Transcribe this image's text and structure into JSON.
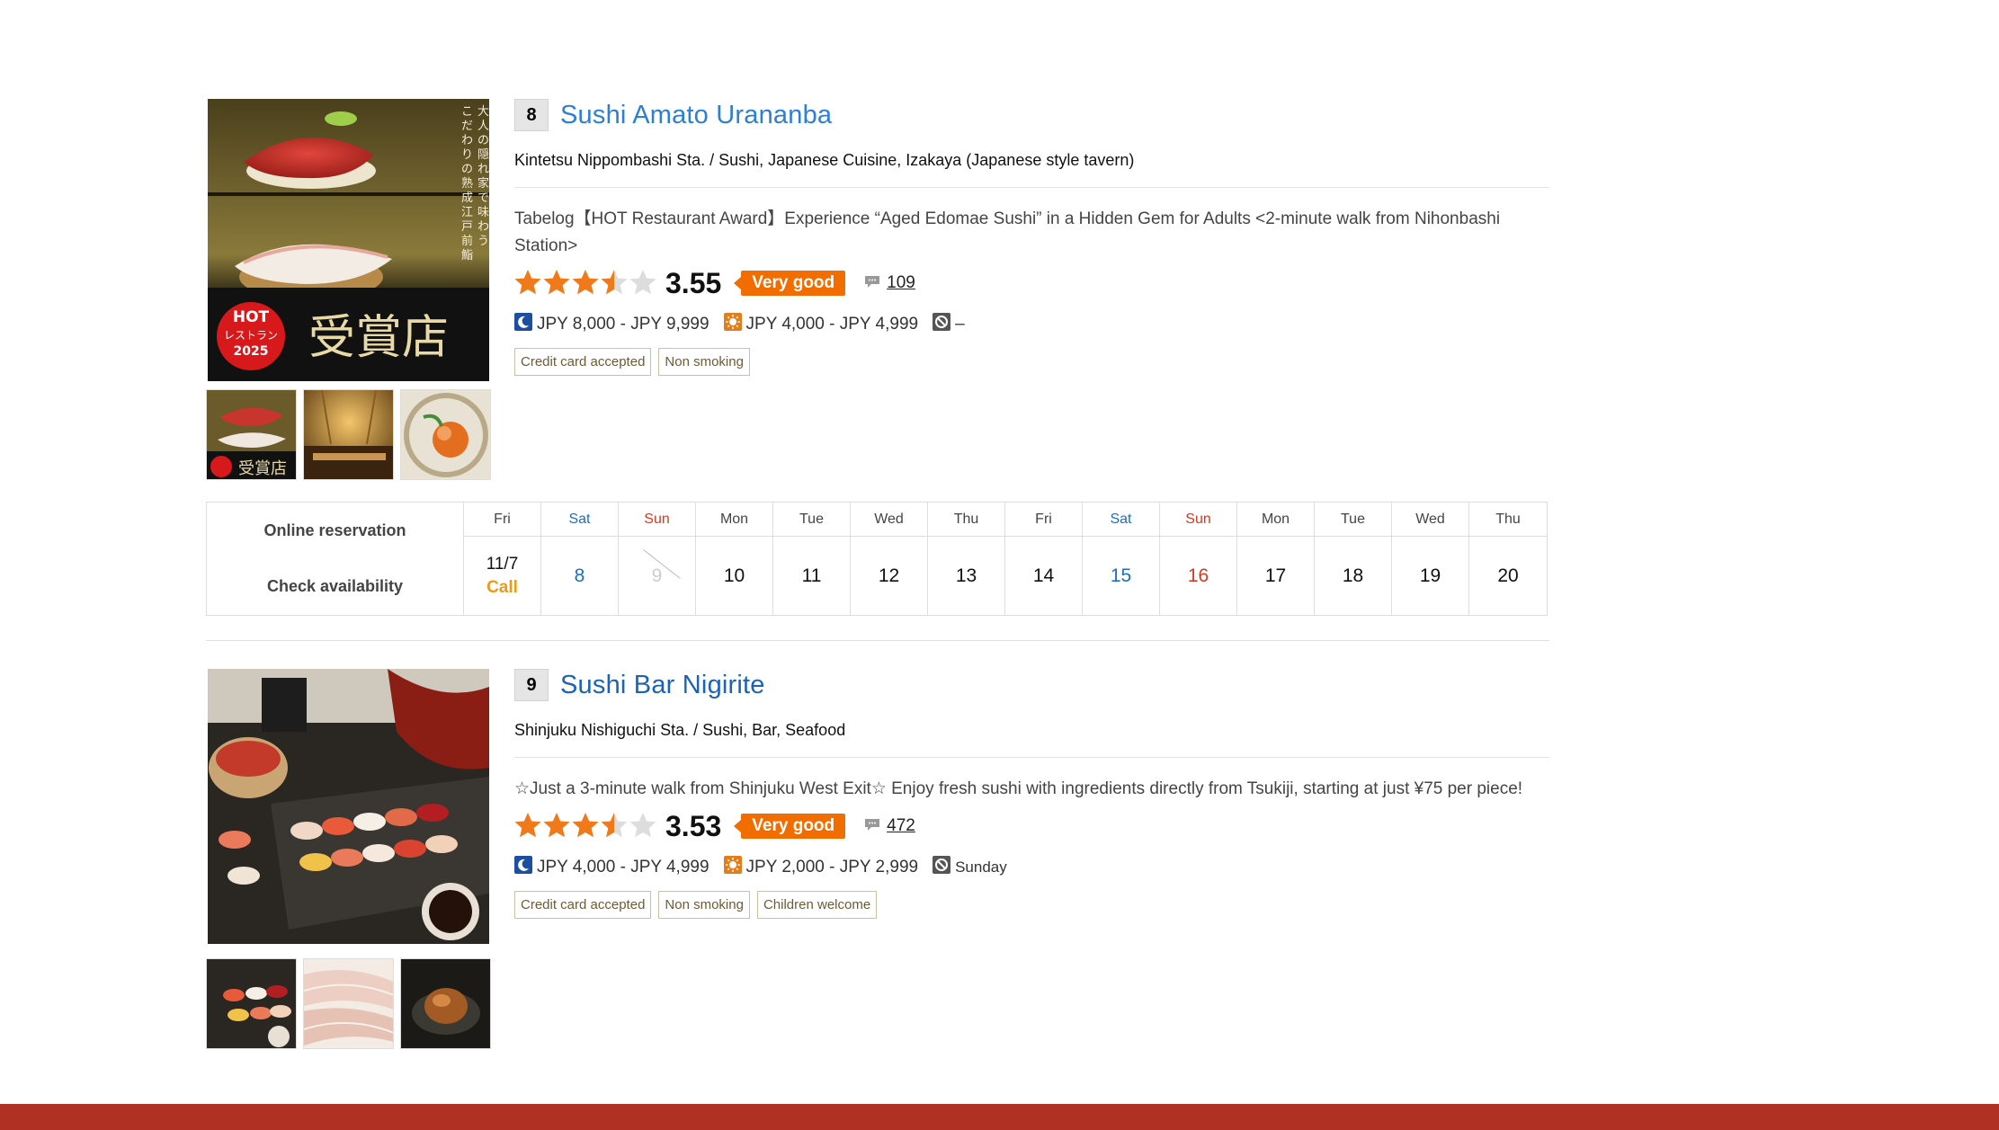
{
  "listings": [
    {
      "rank": "8",
      "name": "Sushi Amato Urananba",
      "area": "Kintetsu Nippombashi Sta. / Sushi, Japanese Cuisine, Izakaya (Japanese style tavern)",
      "pr": "Tabelog【HOT Restaurant Award】Experience “Aged Edomae Sushi” in a Hidden Gem for Adults <2-minute walk from Nihonbashi Station>",
      "rating": {
        "score": "3.55",
        "stars": 3.5,
        "label": "Very good"
      },
      "reviews": "109",
      "dinner_price": "JPY 8,000 - JPY 9,999",
      "lunch_price": "JPY 4,000 - JPY 4,999",
      "holiday": "–",
      "tags": [
        "Credit card accepted",
        "Non smoking"
      ],
      "photo": {
        "award_badge": "HOT\nレストラン\n2025",
        "award_text": "受賞店",
        "vertical_text": "大人の隠れ家で味わうこだわりの熟成江戸前鮨"
      }
    },
    {
      "rank": "9",
      "name": "Sushi Bar Nigirite",
      "area": "Shinjuku Nishiguchi Sta. / Sushi, Bar, Seafood",
      "pr": "☆Just a 3-minute walk from Shinjuku West Exit☆ Enjoy fresh sushi with ingredients directly from Tsukiji, starting at just ¥75 per piece!",
      "rating": {
        "score": "3.53",
        "stars": 3.5,
        "label": "Very good"
      },
      "reviews": "472",
      "dinner_price": "JPY 4,000 - JPY 4,999",
      "lunch_price": "JPY 2,000 - JPY 2,999",
      "holiday": "Sunday",
      "tags": [
        "Credit card accepted",
        "Non smoking",
        "Children welcome"
      ]
    }
  ],
  "reservation": {
    "online_label": "Online reservation",
    "check_label": "Check availability",
    "days": [
      {
        "dow": "Fri",
        "date": "11/7",
        "extra": "Call",
        "kind": "wd"
      },
      {
        "dow": "Sat",
        "date": "8",
        "kind": "sat"
      },
      {
        "dow": "Sun",
        "date": "9",
        "kind": "sun",
        "closed": true
      },
      {
        "dow": "Mon",
        "date": "10",
        "kind": "wd"
      },
      {
        "dow": "Tue",
        "date": "11",
        "kind": "wd"
      },
      {
        "dow": "Wed",
        "date": "12",
        "kind": "wd"
      },
      {
        "dow": "Thu",
        "date": "13",
        "kind": "wd"
      },
      {
        "dow": "Fri",
        "date": "14",
        "kind": "wd"
      },
      {
        "dow": "Sat",
        "date": "15",
        "kind": "sat"
      },
      {
        "dow": "Sun",
        "date": "16",
        "kind": "sun"
      },
      {
        "dow": "Mon",
        "date": "17",
        "kind": "wd"
      },
      {
        "dow": "Tue",
        "date": "18",
        "kind": "wd"
      },
      {
        "dow": "Wed",
        "date": "19",
        "kind": "wd"
      },
      {
        "dow": "Thu",
        "date": "20",
        "kind": "wd"
      }
    ]
  },
  "icons": {
    "dinner": "moon-icon",
    "lunch": "sun-icon",
    "holiday": "closed-day-icon",
    "review": "speech-bubble-icon"
  },
  "colors": {
    "link": "#2d7fd4",
    "badge": "#f26d00",
    "star": "#f07a1a",
    "footer": "#b13024"
  }
}
